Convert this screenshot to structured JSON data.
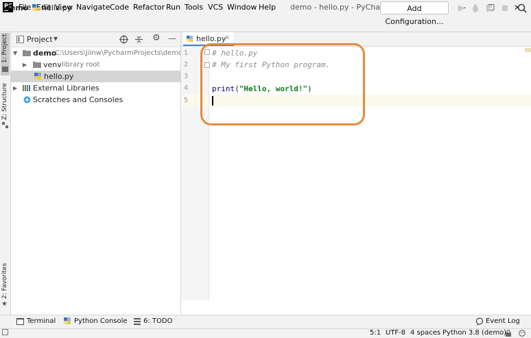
{
  "window": {
    "title": "demo - hello.py - PyCharm",
    "logo_text": "PC",
    "controls": [
      "—",
      "☐",
      "✕"
    ]
  },
  "menu": [
    "File",
    "Edit",
    "View",
    "Navigate",
    "Code",
    "Refactor",
    "Run",
    "Tools",
    "VCS",
    "Window",
    "Help"
  ],
  "navbar": {
    "breadcrumb_project": "demo",
    "breadcrumb_sep": "›",
    "breadcrumb_file": "hello.py",
    "add_configuration": "Add Configuration..."
  },
  "left_stripe": {
    "project_tab": "1: Project",
    "structure_tab": "Z: Structure",
    "favorites_tab": "2: Favorites"
  },
  "project_panel": {
    "header_label": "Project",
    "tree": [
      {
        "name": "demo",
        "detail": "C:\\Users\\jiinw\\PycharmProjects\\demo",
        "icon": "folder-icon"
      },
      {
        "name": "venv",
        "detail": "library root",
        "icon": "folder-icon"
      },
      {
        "name": "hello.py",
        "detail": "",
        "icon": "python-file-icon"
      },
      {
        "name": "External Libraries",
        "detail": "",
        "icon": "libraries-icon"
      },
      {
        "name": "Scratches and Consoles",
        "detail": "",
        "icon": "scratches-icon"
      }
    ]
  },
  "editor": {
    "tab_label": "hello.py",
    "line_numbers": [
      "1",
      "2",
      "3",
      "4",
      "5"
    ],
    "lines": {
      "l1": "# hello.py",
      "l2": "# My first Python program.",
      "l4_func": "print",
      "l4_open": "(",
      "l4_str": "\"Hello, world!\"",
      "l4_close": ")"
    }
  },
  "bottom_tools": {
    "terminal": "Terminal",
    "python_console": "Python Console",
    "todo": "6: TODO",
    "event_log": "Event Log"
  },
  "status": {
    "position": "5:1",
    "encoding": "UTF-8",
    "indent": "4 spaces",
    "interpreter": "Python 3.8 (demo)"
  },
  "colors": {
    "highlight_ring": "#e58a3c",
    "tab_underline": "#4083c9",
    "string": "#067d17",
    "comment": "#8c8c8c"
  }
}
